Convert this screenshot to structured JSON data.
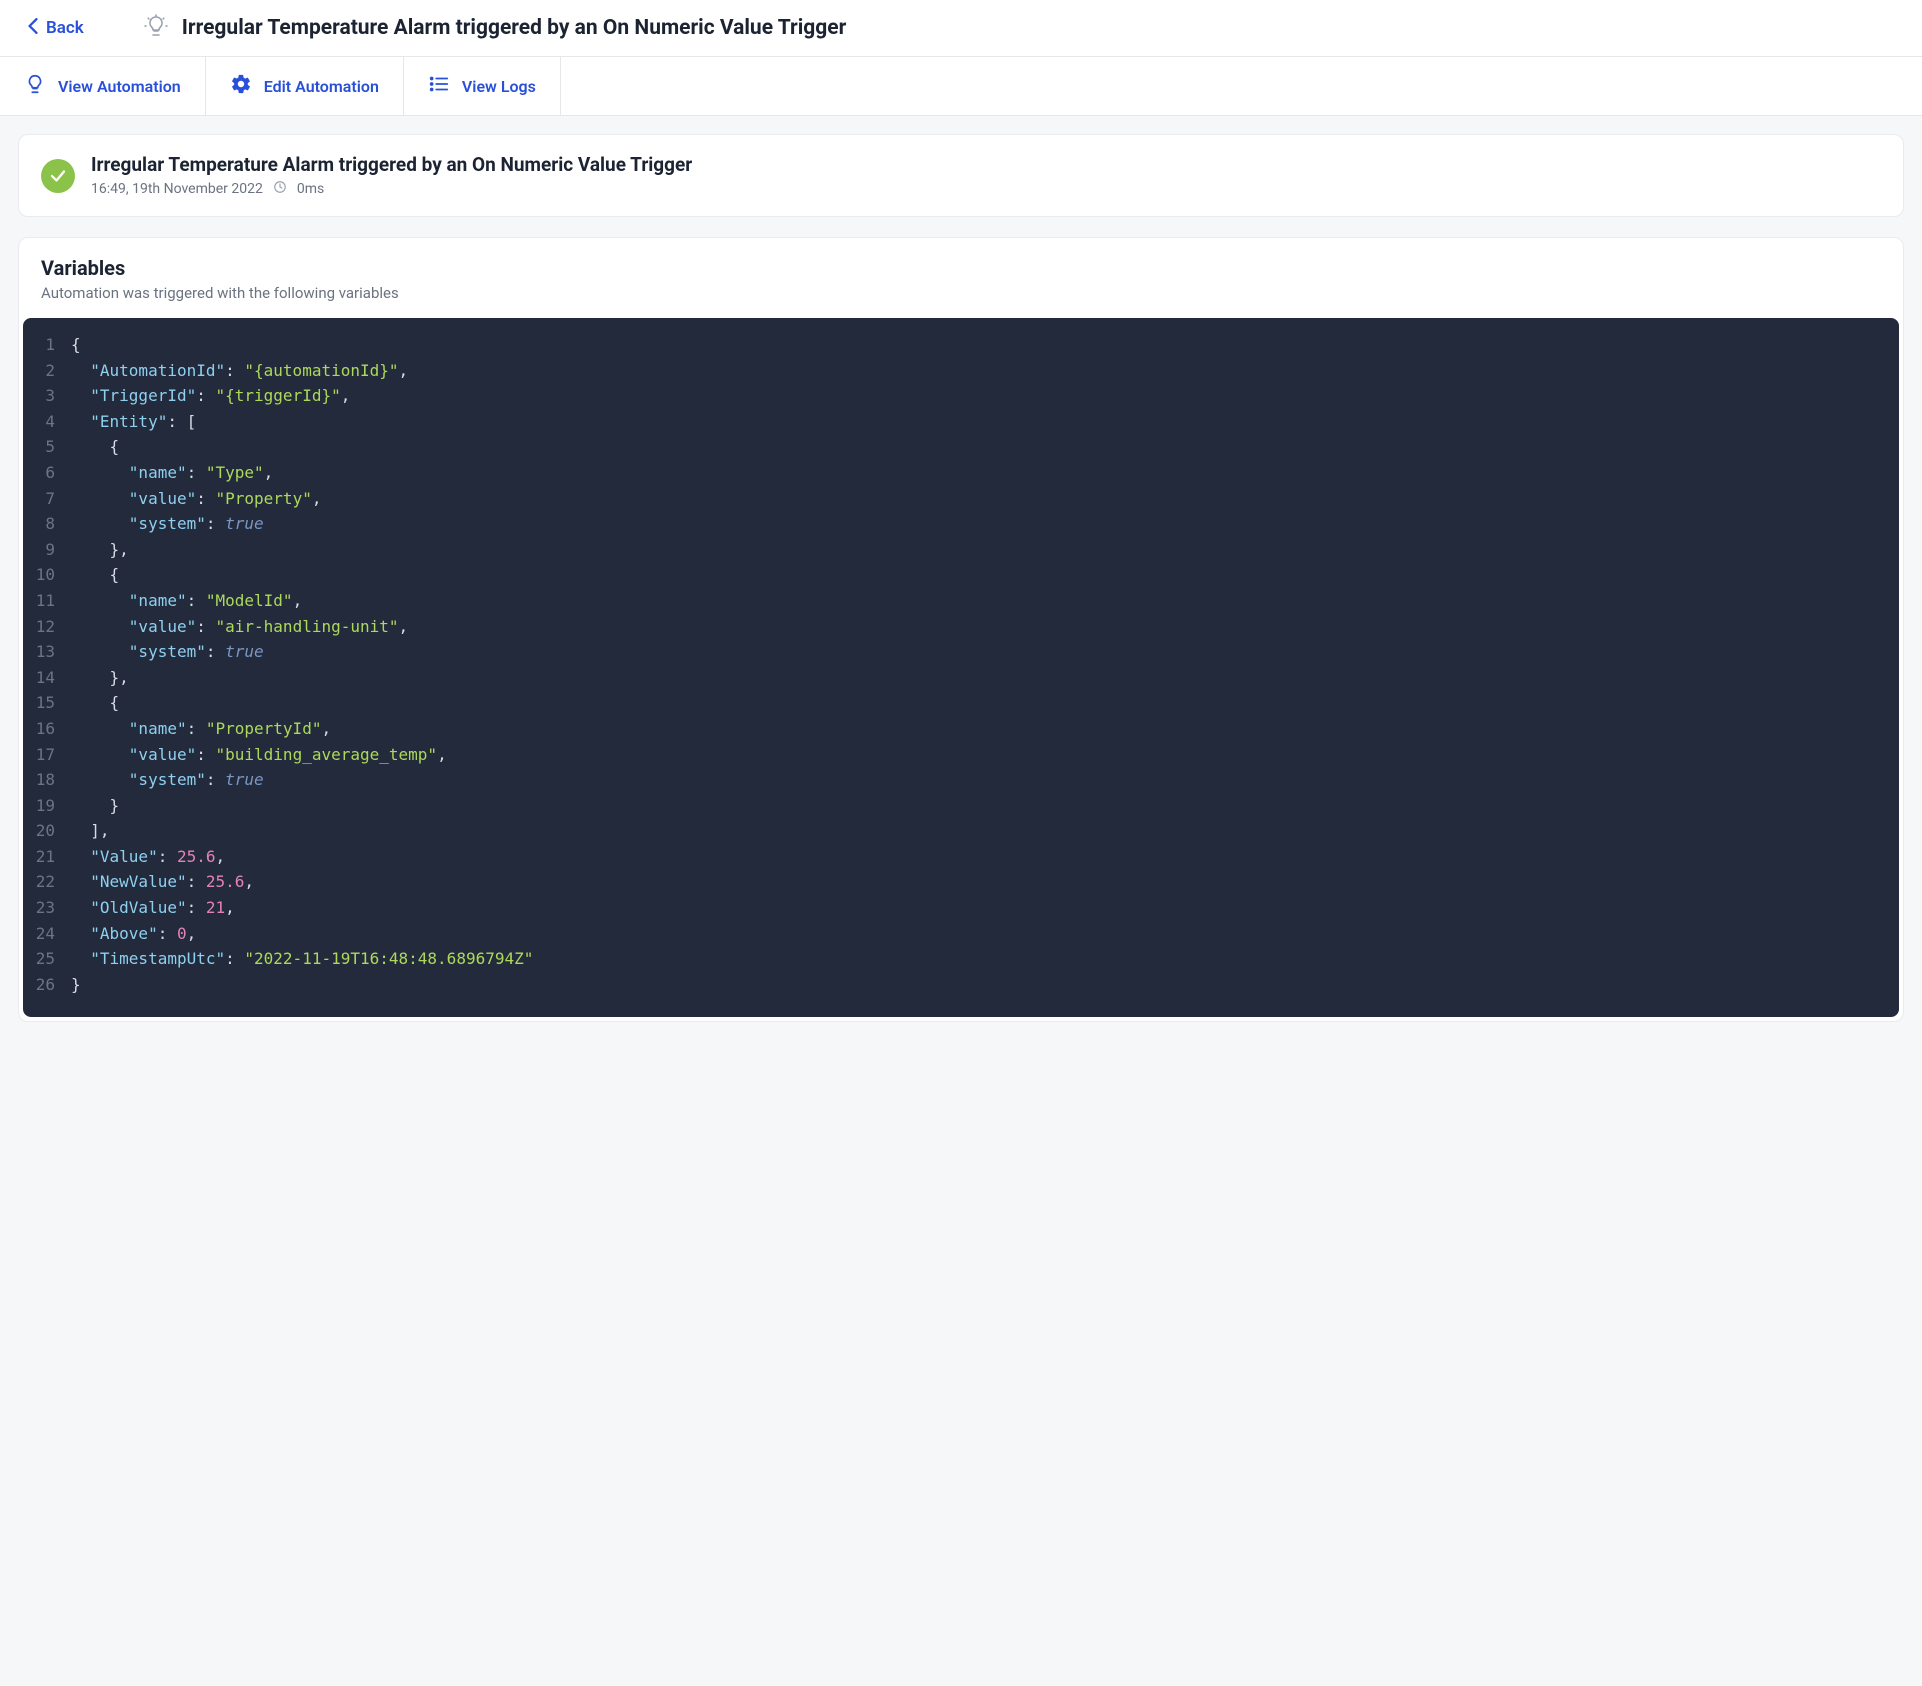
{
  "header": {
    "back_label": "Back",
    "title": "Irregular Temperature Alarm triggered by an On Numeric Value Trigger"
  },
  "toolbar": {
    "view_automation": "View Automation",
    "edit_automation": "Edit Automation",
    "view_logs": "View Logs"
  },
  "status": {
    "title": "Irregular Temperature Alarm triggered by an On Numeric Value Trigger",
    "timestamp": "16:49, 19th November 2022",
    "duration": "0ms"
  },
  "variables": {
    "heading": "Variables",
    "subheading": "Automation was triggered with the following variables",
    "code_lines": [
      [
        {
          "t": "punct",
          "v": "{"
        }
      ],
      [
        {
          "t": "punct",
          "v": "  "
        },
        {
          "t": "key",
          "v": "\"AutomationId\""
        },
        {
          "t": "punct",
          "v": ": "
        },
        {
          "t": "str",
          "v": "\"{automationId}\""
        },
        {
          "t": "punct",
          "v": ","
        }
      ],
      [
        {
          "t": "punct",
          "v": "  "
        },
        {
          "t": "key",
          "v": "\"TriggerId\""
        },
        {
          "t": "punct",
          "v": ": "
        },
        {
          "t": "str",
          "v": "\"{triggerId}\""
        },
        {
          "t": "punct",
          "v": ","
        }
      ],
      [
        {
          "t": "punct",
          "v": "  "
        },
        {
          "t": "key",
          "v": "\"Entity\""
        },
        {
          "t": "punct",
          "v": ": ["
        }
      ],
      [
        {
          "t": "punct",
          "v": "    {"
        }
      ],
      [
        {
          "t": "punct",
          "v": "      "
        },
        {
          "t": "key",
          "v": "\"name\""
        },
        {
          "t": "punct",
          "v": ": "
        },
        {
          "t": "str",
          "v": "\"Type\""
        },
        {
          "t": "punct",
          "v": ","
        }
      ],
      [
        {
          "t": "punct",
          "v": "      "
        },
        {
          "t": "key",
          "v": "\"value\""
        },
        {
          "t": "punct",
          "v": ": "
        },
        {
          "t": "str",
          "v": "\"Property\""
        },
        {
          "t": "punct",
          "v": ","
        }
      ],
      [
        {
          "t": "punct",
          "v": "      "
        },
        {
          "t": "key",
          "v": "\"system\""
        },
        {
          "t": "punct",
          "v": ": "
        },
        {
          "t": "bool",
          "v": "true"
        }
      ],
      [
        {
          "t": "punct",
          "v": "    },"
        }
      ],
      [
        {
          "t": "punct",
          "v": "    {"
        }
      ],
      [
        {
          "t": "punct",
          "v": "      "
        },
        {
          "t": "key",
          "v": "\"name\""
        },
        {
          "t": "punct",
          "v": ": "
        },
        {
          "t": "str",
          "v": "\"ModelId\""
        },
        {
          "t": "punct",
          "v": ","
        }
      ],
      [
        {
          "t": "punct",
          "v": "      "
        },
        {
          "t": "key",
          "v": "\"value\""
        },
        {
          "t": "punct",
          "v": ": "
        },
        {
          "t": "str",
          "v": "\"air-handling-unit\""
        },
        {
          "t": "punct",
          "v": ","
        }
      ],
      [
        {
          "t": "punct",
          "v": "      "
        },
        {
          "t": "key",
          "v": "\"system\""
        },
        {
          "t": "punct",
          "v": ": "
        },
        {
          "t": "bool",
          "v": "true"
        }
      ],
      [
        {
          "t": "punct",
          "v": "    },"
        }
      ],
      [
        {
          "t": "punct",
          "v": "    {"
        }
      ],
      [
        {
          "t": "punct",
          "v": "      "
        },
        {
          "t": "key",
          "v": "\"name\""
        },
        {
          "t": "punct",
          "v": ": "
        },
        {
          "t": "str",
          "v": "\"PropertyId\""
        },
        {
          "t": "punct",
          "v": ","
        }
      ],
      [
        {
          "t": "punct",
          "v": "      "
        },
        {
          "t": "key",
          "v": "\"value\""
        },
        {
          "t": "punct",
          "v": ": "
        },
        {
          "t": "str",
          "v": "\"building_average_temp\""
        },
        {
          "t": "punct",
          "v": ","
        }
      ],
      [
        {
          "t": "punct",
          "v": "      "
        },
        {
          "t": "key",
          "v": "\"system\""
        },
        {
          "t": "punct",
          "v": ": "
        },
        {
          "t": "bool",
          "v": "true"
        }
      ],
      [
        {
          "t": "punct",
          "v": "    }"
        }
      ],
      [
        {
          "t": "punct",
          "v": "  ],"
        }
      ],
      [
        {
          "t": "punct",
          "v": "  "
        },
        {
          "t": "key",
          "v": "\"Value\""
        },
        {
          "t": "punct",
          "v": ": "
        },
        {
          "t": "num",
          "v": "25.6"
        },
        {
          "t": "punct",
          "v": ","
        }
      ],
      [
        {
          "t": "punct",
          "v": "  "
        },
        {
          "t": "key",
          "v": "\"NewValue\""
        },
        {
          "t": "punct",
          "v": ": "
        },
        {
          "t": "num",
          "v": "25.6"
        },
        {
          "t": "punct",
          "v": ","
        }
      ],
      [
        {
          "t": "punct",
          "v": "  "
        },
        {
          "t": "key",
          "v": "\"OldValue\""
        },
        {
          "t": "punct",
          "v": ": "
        },
        {
          "t": "num",
          "v": "21"
        },
        {
          "t": "punct",
          "v": ","
        }
      ],
      [
        {
          "t": "punct",
          "v": "  "
        },
        {
          "t": "key",
          "v": "\"Above\""
        },
        {
          "t": "punct",
          "v": ": "
        },
        {
          "t": "num",
          "v": "0"
        },
        {
          "t": "punct",
          "v": ","
        }
      ],
      [
        {
          "t": "punct",
          "v": "  "
        },
        {
          "t": "key",
          "v": "\"TimestampUtc\""
        },
        {
          "t": "punct",
          "v": ": "
        },
        {
          "t": "str",
          "v": "\"2022-11-19T16:48:48.6896794Z\""
        }
      ],
      [
        {
          "t": "punct",
          "v": "}"
        }
      ]
    ]
  }
}
